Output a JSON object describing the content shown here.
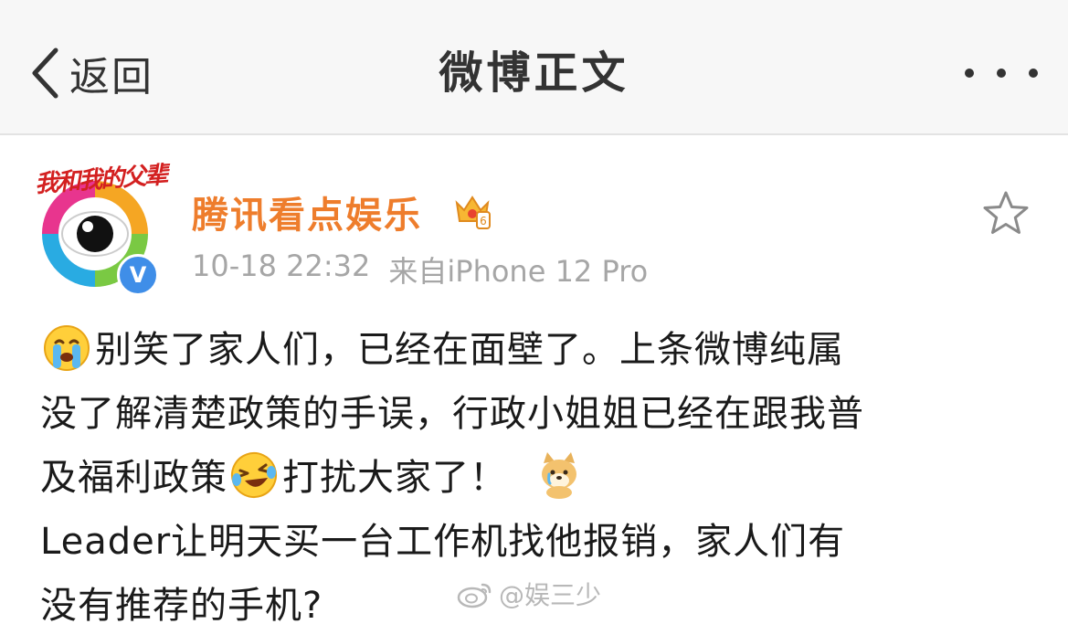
{
  "navbar": {
    "back_label": "返回",
    "title": "微博正文",
    "more_icon": "more-horizontal-icon"
  },
  "post": {
    "avatar_caption": "我和我的父辈",
    "verified_badge": "V",
    "username": "腾讯看点娱乐",
    "timestamp": "10-18 22:32",
    "source": "来自iPhone 12 Pro",
    "lines": [
      "别笑了家人们，已经在面壁了。上条微博纯属",
      "没了解清楚政策的手误，行政小姐姐已经在跟我普",
      "及福利政策",
      "打扰大家了！",
      "Leader让明天买一台工作机找他报销，家人们有",
      "没有推荐的手机?"
    ],
    "emojis": [
      "crying-face-icon",
      "laughing-tears-face-icon",
      "crying-doge-icon"
    ]
  },
  "watermark": {
    "text": "@娱三少"
  },
  "colors": {
    "username": "#ee7d2c",
    "meta": "#a6a6a6",
    "navbar_bg": "#f7f7f7",
    "verified": "#3f8ee8"
  }
}
